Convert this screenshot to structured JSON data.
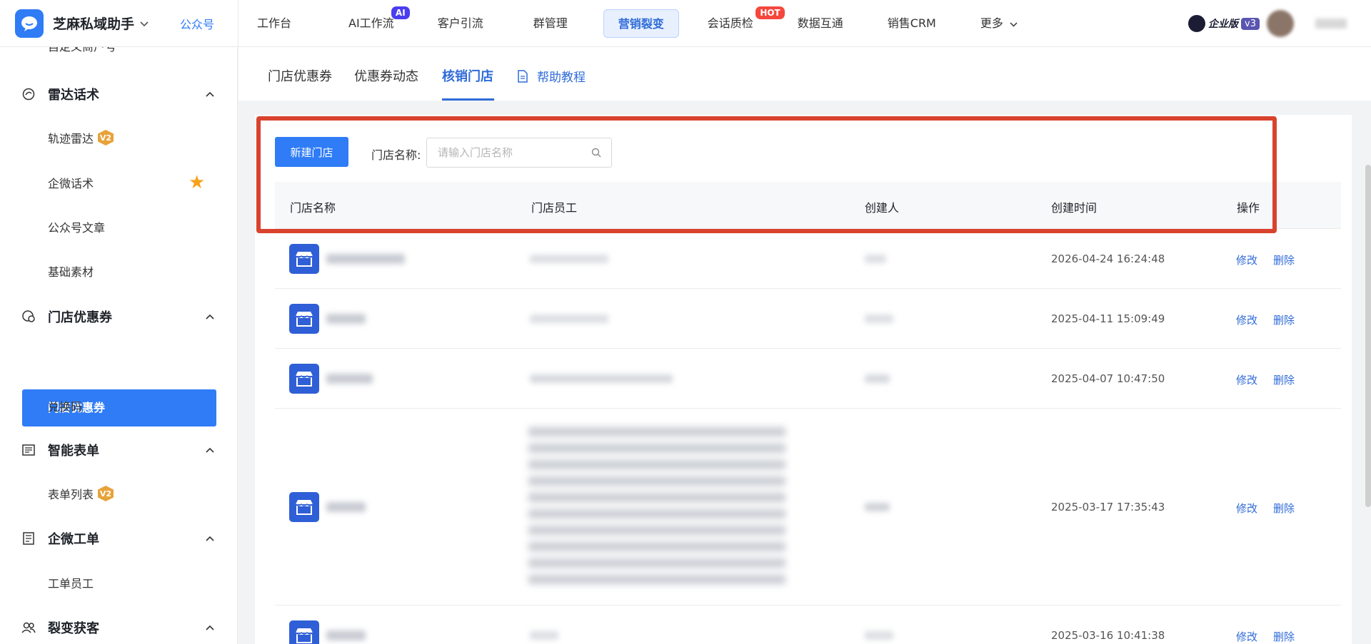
{
  "topbar": {
    "brand_name": "芝麻私域助手",
    "brand_link": "公众号",
    "nav": [
      {
        "label": "工作台"
      },
      {
        "label": "AI工作流",
        "badge": "AI"
      },
      {
        "label": "客户引流"
      },
      {
        "label": "群管理"
      },
      {
        "label": "营销裂变",
        "active": true
      },
      {
        "label": "会话质检",
        "badge": "HOT"
      },
      {
        "label": "数据互通"
      },
      {
        "label": "销售CRM"
      },
      {
        "label": "更多"
      }
    ],
    "edition": "企业版",
    "edition_version": "v3"
  },
  "sidebar": {
    "cut_item": "自定义商户号",
    "groups": [
      {
        "label": "雷达话术"
      },
      {
        "label": "门店优惠券"
      },
      {
        "label": "智能表单"
      },
      {
        "label": "企微工单"
      },
      {
        "label": "裂变获客"
      }
    ],
    "items": [
      {
        "label": "轨迹雷达",
        "badge": "V2"
      },
      {
        "label": "企微话术"
      },
      {
        "label": "公众号文章"
      },
      {
        "label": "基础素材"
      },
      {
        "label": "门店优惠券",
        "active": true
      },
      {
        "label": "兑换码"
      },
      {
        "label": "表单列表",
        "badge": "V2"
      },
      {
        "label": "工单员工"
      }
    ]
  },
  "tabs": [
    {
      "label": "门店优惠券"
    },
    {
      "label": "优惠券动态"
    },
    {
      "label": "核销门店",
      "active": true
    }
  ],
  "help_link": "帮助教程",
  "toolbar": {
    "new_button": "新建门店",
    "search_label": "门店名称:",
    "search_placeholder": "请输入门店名称"
  },
  "table": {
    "columns": [
      "门店名称",
      "门店员工",
      "创建人",
      "创建时间",
      "操作"
    ],
    "rows": [
      {
        "created_at": "2026-04-24 16:24:48",
        "edit": "修改",
        "delete": "删除"
      },
      {
        "created_at": "2025-04-11 15:09:49",
        "edit": "修改",
        "delete": "删除"
      },
      {
        "created_at": "2025-04-07 10:47:50",
        "edit": "修改",
        "delete": "删除"
      },
      {
        "created_at": "2025-03-17 17:35:43",
        "edit": "修改",
        "delete": "删除"
      },
      {
        "created_at": "2025-03-16 10:41:38",
        "edit": "修改",
        "delete": "删除"
      }
    ]
  },
  "colors": {
    "primary": "#2f7cf6",
    "highlight_border": "#d9432e",
    "hot_badge": "#f5473d",
    "ai_badge": "#4b3cf0",
    "star": "#f7a21b"
  }
}
